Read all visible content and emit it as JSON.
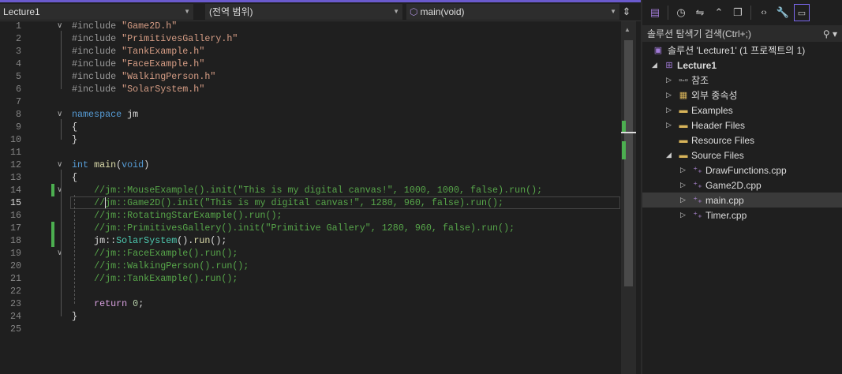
{
  "navbar": {
    "project": "Lecture1",
    "scope": "(전역 범위)",
    "member": "main(void)"
  },
  "editor": {
    "current_line": 15,
    "changed_lines": [
      14,
      17,
      18
    ],
    "lines": [
      [
        [
          "pp",
          "#include "
        ],
        [
          "str",
          "\"Game2D.h\""
        ]
      ],
      [
        [
          "pp",
          "#include "
        ],
        [
          "str",
          "\"PrimitivesGallery.h\""
        ]
      ],
      [
        [
          "pp",
          "#include "
        ],
        [
          "str",
          "\"TankExample.h\""
        ]
      ],
      [
        [
          "pp",
          "#include "
        ],
        [
          "str",
          "\"FaceExample.h\""
        ]
      ],
      [
        [
          "pp",
          "#include "
        ],
        [
          "str",
          "\"WalkingPerson.h\""
        ]
      ],
      [
        [
          "pp",
          "#include "
        ],
        [
          "str",
          "\"SolarSystem.h\""
        ]
      ],
      [],
      [
        [
          "kw",
          "namespace"
        ],
        [
          "pl",
          " jm"
        ]
      ],
      [
        [
          "pl",
          "{"
        ]
      ],
      [
        [
          "pl",
          "}"
        ]
      ],
      [],
      [
        [
          "kw",
          "int"
        ],
        [
          "pl",
          " "
        ],
        [
          "fn",
          "main"
        ],
        [
          "pl",
          "("
        ],
        [
          "kw",
          "void"
        ],
        [
          "pl",
          ")"
        ]
      ],
      [
        [
          "pl",
          "{"
        ]
      ],
      [
        [
          "pl",
          "    "
        ],
        [
          "cm",
          "//jm::MouseExample().init(\"This is my digital canvas!\", 1000, 1000, false).run();"
        ]
      ],
      [
        [
          "pl",
          "    "
        ],
        [
          "cm",
          "//jm::Game2D().init(\"This is my digital canvas!\", 1280, 960, false).run();"
        ]
      ],
      [
        [
          "pl",
          "    "
        ],
        [
          "cm",
          "//jm::RotatingStarExample().run();"
        ]
      ],
      [
        [
          "pl",
          "    "
        ],
        [
          "cm",
          "//jm::PrimitivesGallery().init(\"Primitive Gallery\", 1280, 960, false).run();"
        ]
      ],
      [
        [
          "pl",
          "    jm::"
        ],
        [
          "ty",
          "SolarSystem"
        ],
        [
          "pl",
          "()."
        ],
        [
          "fn",
          "run"
        ],
        [
          "pl",
          "();"
        ]
      ],
      [
        [
          "pl",
          "    "
        ],
        [
          "cm",
          "//jm::FaceExample().run();"
        ]
      ],
      [
        [
          "pl",
          "    "
        ],
        [
          "cm",
          "//jm::WalkingPerson().run();"
        ]
      ],
      [
        [
          "pl",
          "    "
        ],
        [
          "cm",
          "//jm::TankExample().run();"
        ]
      ],
      [],
      [
        [
          "pl",
          "    "
        ],
        [
          "ctl",
          "return"
        ],
        [
          "pl",
          " "
        ],
        [
          "num",
          "0"
        ],
        [
          "pl",
          ";"
        ]
      ],
      [
        [
          "pl",
          "}"
        ]
      ],
      []
    ],
    "fold_lines": [
      1,
      8,
      12,
      14,
      19
    ]
  },
  "solution_explorer": {
    "search_placeholder": "솔루션 탐색기 검색(Ctrl+;)",
    "solution": "솔루션 'Lecture1' (1 프로젝트의 1)",
    "items": [
      {
        "label": "Lecture1",
        "level": 0,
        "expand": "open",
        "icon": "project-icon",
        "bold": true
      },
      {
        "label": "참조",
        "level": 1,
        "expand": "closed",
        "icon": "references-icon"
      },
      {
        "label": "외부 종속성",
        "level": 1,
        "expand": "closed",
        "icon": "external-deps-icon"
      },
      {
        "label": "Examples",
        "level": 1,
        "expand": "closed",
        "icon": "filter-folder-icon"
      },
      {
        "label": "Header Files",
        "level": 1,
        "expand": "closed",
        "icon": "filter-folder-icon"
      },
      {
        "label": "Resource Files",
        "level": 1,
        "expand": "none",
        "icon": "filter-folder-icon"
      },
      {
        "label": "Source Files",
        "level": 1,
        "expand": "open",
        "icon": "filter-folder-icon"
      },
      {
        "label": "DrawFunctions.cpp",
        "level": 2,
        "expand": "closed",
        "icon": "cpp-file-icon"
      },
      {
        "label": "Game2D.cpp",
        "level": 2,
        "expand": "closed",
        "icon": "cpp-file-icon"
      },
      {
        "label": "main.cpp",
        "level": 2,
        "expand": "closed",
        "icon": "cpp-file-icon",
        "selected": true
      },
      {
        "label": "Timer.cpp",
        "level": 2,
        "expand": "closed",
        "icon": "cpp-file-icon"
      }
    ]
  }
}
